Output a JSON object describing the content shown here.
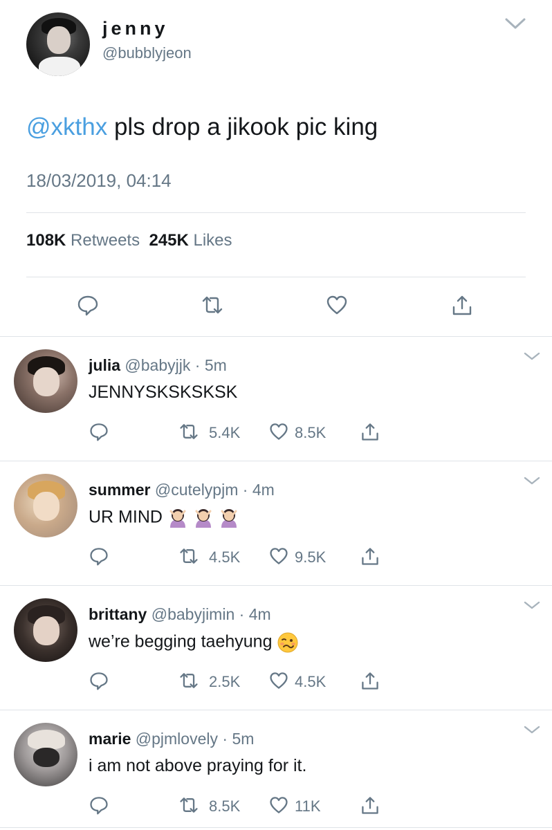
{
  "main_tweet": {
    "display_name": "jenny",
    "handle": "@bubblyjeon",
    "mention": "@xkthx",
    "text": " pls drop a jikook pic king",
    "timestamp": "18/03/2019, 04:14",
    "retweets_count": "108K",
    "retweets_label": "Retweets",
    "likes_count": "245K",
    "likes_label": "Likes",
    "actions": [
      "reply-icon",
      "retweet-icon",
      "like-icon",
      "share-icon"
    ]
  },
  "replies": [
    {
      "display_name": "julia",
      "handle": "@babyjjk",
      "separator": "·",
      "time": "5m",
      "text": "JENNYSKSKSKSK",
      "emoji": [],
      "retweets": "5.4K",
      "likes": "8.5K"
    },
    {
      "display_name": "summer",
      "handle": "@cutelypjm",
      "separator": "·",
      "time": "4m",
      "text": "UR MIND ",
      "emoji": [
        "person-gesturing-no-icon",
        "person-gesturing-no-icon",
        "person-gesturing-no-icon"
      ],
      "retweets": "4.5K",
      "likes": "9.5K"
    },
    {
      "display_name": "brittany",
      "handle": "@babyjimin",
      "separator": "·",
      "time": "4m",
      "text": "we’re begging taehyung ",
      "emoji": [
        "woozy-face-icon"
      ],
      "retweets": "2.5K",
      "likes": "4.5K"
    },
    {
      "display_name": "marie",
      "handle": "@pjmlovely",
      "separator": "·",
      "time": "5m",
      "text": "i am not above praying for it.",
      "emoji": [],
      "retweets": "8.5K",
      "likes": "11K"
    }
  ],
  "colors": {
    "mention": "#4a9fe0",
    "secondary_text": "#657786",
    "primary_text": "#14171a",
    "divider": "#dfe3e7",
    "icon": "#657786"
  }
}
